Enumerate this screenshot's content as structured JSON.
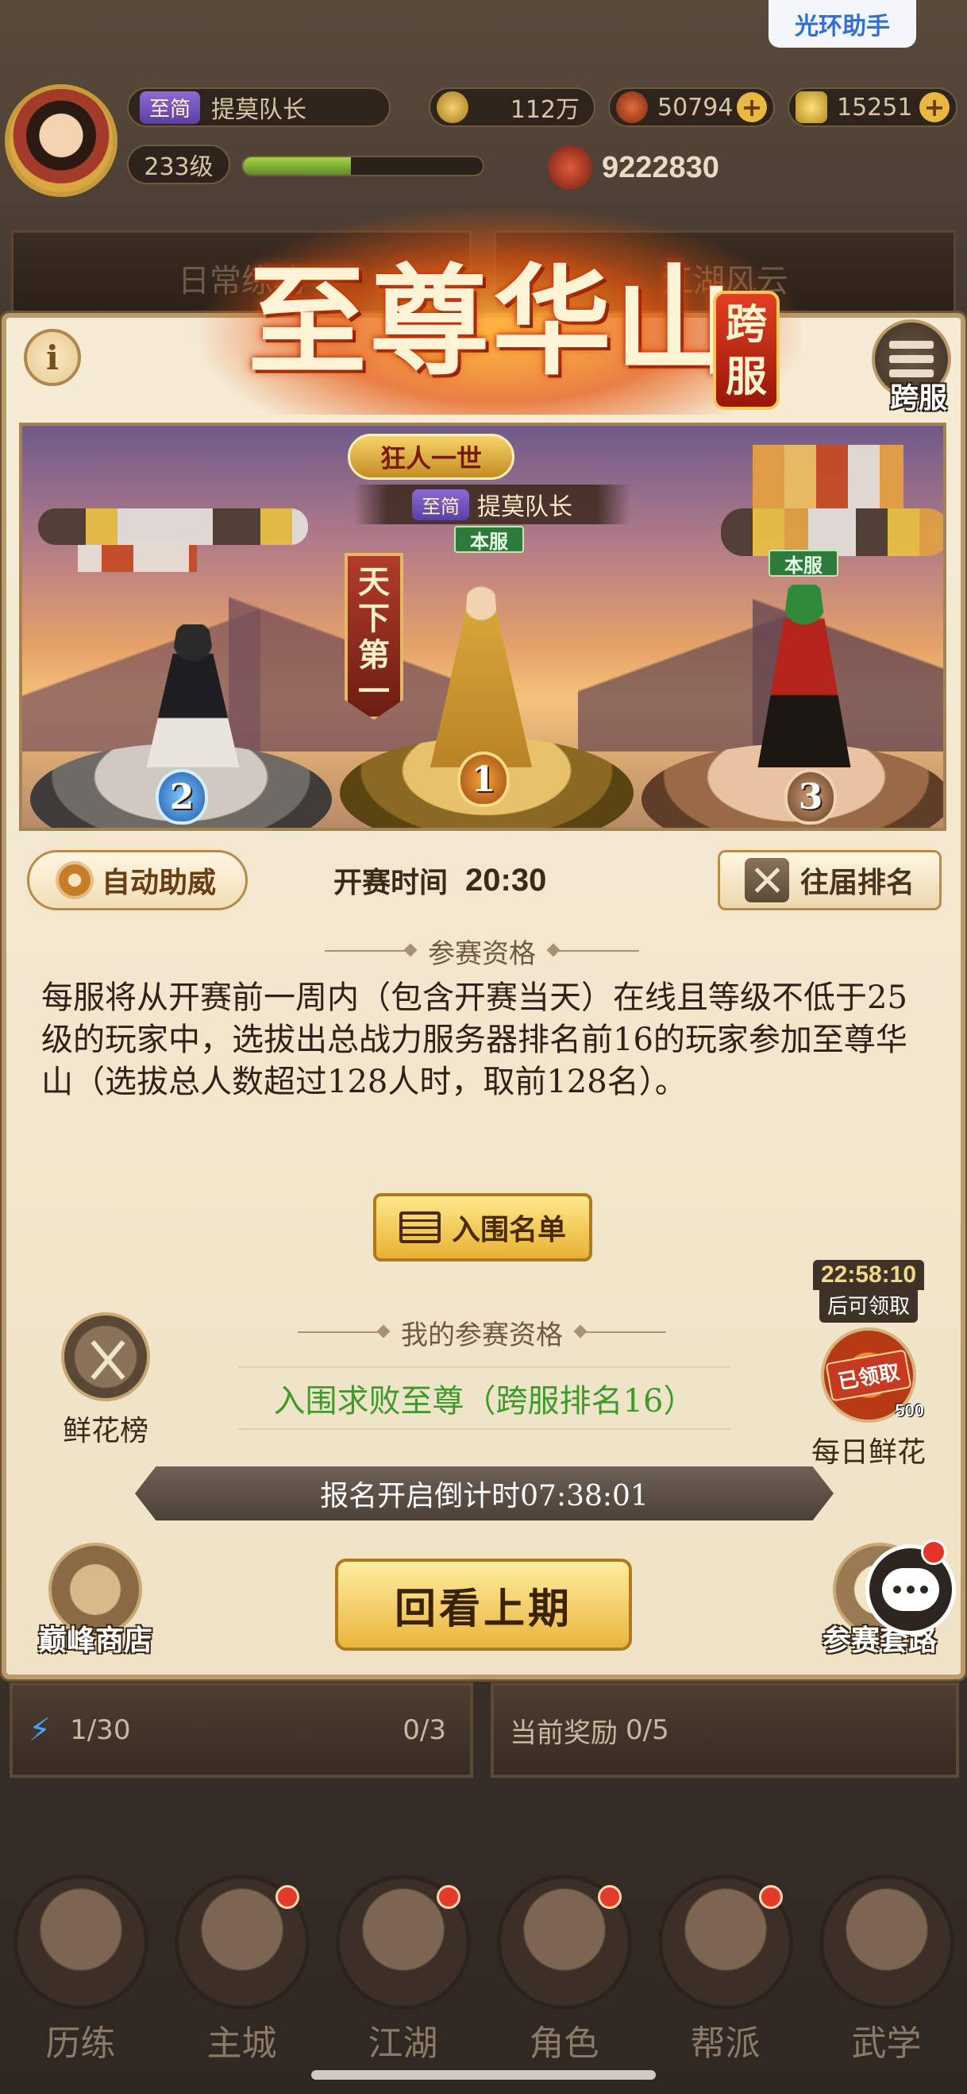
{
  "top_helper": {
    "label": "光环助手"
  },
  "player": {
    "tag": "至简",
    "name": "提莫队长",
    "level_text": "233级",
    "level_progress": 0.45,
    "copper": "112万",
    "ingots": "50794",
    "gold": "15251",
    "power": "9222830"
  },
  "background": {
    "banner_left": "日常练功",
    "banner_right": "江湖风云",
    "strip_left_count": "1/30",
    "strip_left_count2": "0/3",
    "strip_right_label": "当前奖励",
    "strip_right_count": "0/5"
  },
  "panel": {
    "title": "至尊华山",
    "title_badge": "跨服",
    "info_icon": "i",
    "cross_server_label": "跨服",
    "champion_plaque": "狂人一世",
    "first_place_tag": "至简",
    "first_place_name": "提莫队长",
    "first_place_server": "本服",
    "third_place_server": "本服",
    "first_banner": "天下第一",
    "ranks": [
      "1",
      "2",
      "3"
    ],
    "auto_cheer_label": "自动助威",
    "start_time_label": "开赛时间",
    "start_time_value": "20:30",
    "past_rankings_label": "往届排名",
    "qualification_header": "参赛资格",
    "qualification_text": "每服将从开赛前一周内（包含开赛当天）在线且等级不低于25级的玩家中，选拔出总战力服务器排名前16的玩家参加至尊华山（选拔总人数超过128人时，取前128名）。",
    "roster_label": "入围名单",
    "my_qualification_header": "我的参赛资格",
    "my_qualification_status": "入围求败至尊（跨服排名16）",
    "flower_rank_label": "鲜花榜",
    "timer_value": "22:58:10",
    "timer_suffix": "后可领取",
    "claimed_tag": "已领取",
    "flower_count": "500",
    "daily_flower_label": "每日鲜花",
    "countdown_text": "报名开启倒计时07:38:01",
    "peak_shop_label": "巅峰商店",
    "review_label": "回看上期",
    "strategy_label": "参赛套路"
  },
  "bottom_nav": [
    {
      "label": "历练",
      "badge": false
    },
    {
      "label": "主城",
      "badge": true
    },
    {
      "label": "江湖",
      "badge": true
    },
    {
      "label": "角色",
      "badge": true
    },
    {
      "label": "帮派",
      "badge": true
    },
    {
      "label": "武学",
      "badge": false
    }
  ],
  "colors": {
    "accent_gold": "#e8b234",
    "qualified_green": "#3f9a2c",
    "title_red": "#b3220c",
    "helper_blue": "#2f6fd6"
  }
}
